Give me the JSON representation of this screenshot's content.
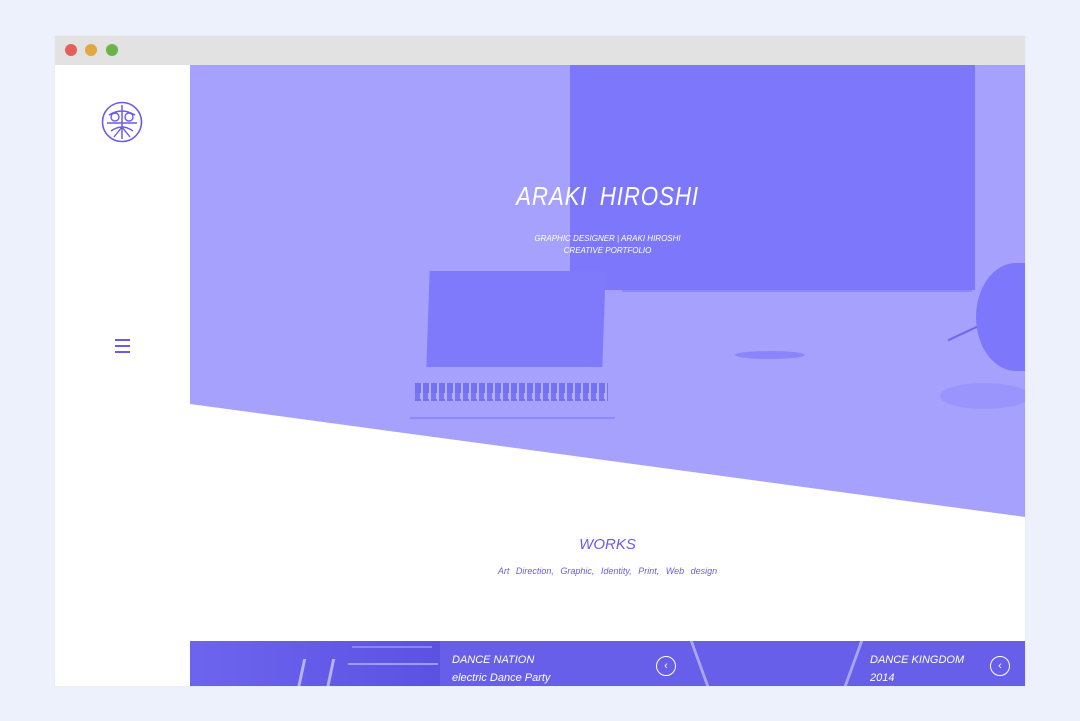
{
  "hero": {
    "title": "ARAKI  HIROSHI",
    "subtitle_line1": "GRAPHIC DESIGNER  |  ARAKI HIROSHI",
    "subtitle_line2": "CREATIVE PORTFOLIO"
  },
  "sidebar": {
    "logo_icon": "circle-monogram-logo",
    "menu_icon": "hamburger-icon"
  },
  "works": {
    "title": "WORKS",
    "categories": "Art Direction,   Graphic,   Identity,   Print,   Web design"
  },
  "cards": [
    {
      "line1": "DANCE NATION",
      "line2": "electric Dance Party",
      "arrow": "‹"
    },
    {
      "line1": "DANCE KINGDOM",
      "line2": "2014",
      "arrow": "‹"
    }
  ],
  "colors": {
    "accent": "#6a5ce8",
    "hero_tint": "#a6a1fd",
    "page_bg": "#edf1fc"
  }
}
